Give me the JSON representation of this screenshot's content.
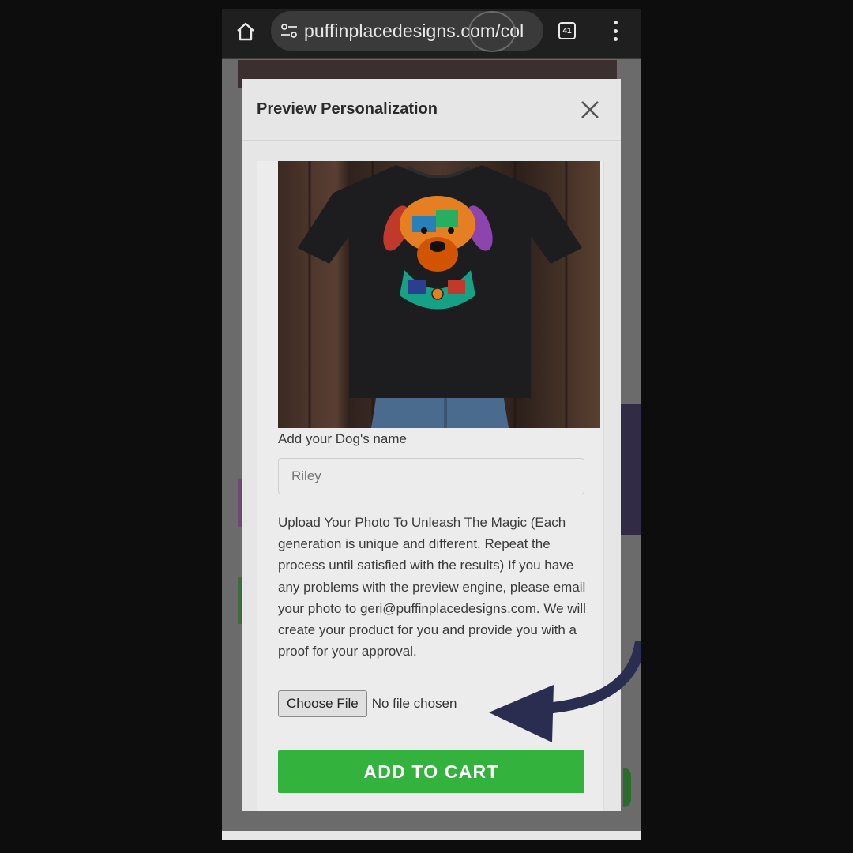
{
  "browser": {
    "url": "puffinplacedesigns.com/col",
    "tab_count": "41"
  },
  "modal": {
    "title": "Preview Personalization"
  },
  "form": {
    "dog_name_label": "Add your Dog's name",
    "dog_name_placeholder": "Riley",
    "upload_instructions": "Upload Your Photo To Unleash The Magic (Each generation is unique and different. Repeat the process until satisfied with the results) If you have any problems with the preview engine, please email your photo to geri@puffinplacedesigns.com. We will create your product for you and provide you with a proof for your approval.",
    "choose_file_label": "Choose File",
    "file_status": "No file chosen",
    "add_to_cart_label": "ADD TO CART"
  },
  "colors": {
    "add_to_cart": "#33b23e",
    "arrow": "#2a2d4f"
  }
}
